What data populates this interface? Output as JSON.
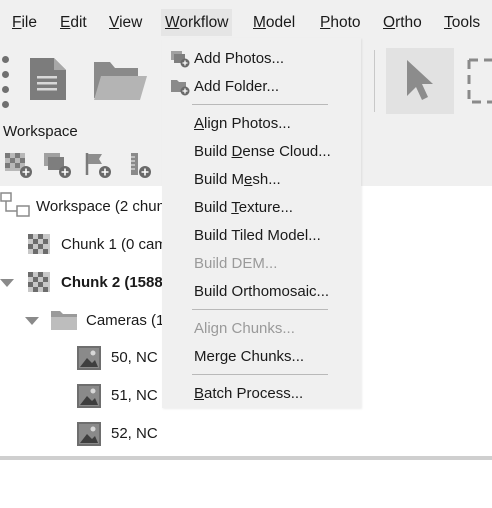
{
  "menubar": {
    "items": [
      {
        "pre": "",
        "u": "F",
        "post": "ile"
      },
      {
        "pre": "",
        "u": "E",
        "post": "dit"
      },
      {
        "pre": "",
        "u": "V",
        "post": "iew"
      },
      {
        "pre": "",
        "u": "W",
        "post": "orkflow"
      },
      {
        "pre": "",
        "u": "M",
        "post": "odel"
      },
      {
        "pre": "",
        "u": "P",
        "post": "hoto"
      },
      {
        "pre": "",
        "u": "O",
        "post": "rtho"
      },
      {
        "pre": "",
        "u": "T",
        "post": "ools"
      }
    ],
    "active_index": 3
  },
  "toolbar": {
    "icons": [
      "new-document-icon",
      "open-folder-icon",
      "pointer-icon",
      "selection-rectangle-icon"
    ]
  },
  "workspace": {
    "title": "Workspace",
    "tools": [
      "add-chunk-icon",
      "add-photos-icon",
      "add-marker-icon",
      "add-scalebar-icon"
    ],
    "tree": {
      "root": "Workspace (2 chun",
      "chunk1": "Chunk 1 (0 cam",
      "chunk2": "Chunk 2 (1588",
      "cameras": "Cameras (1",
      "photos": [
        "50, NC",
        "51, NC",
        "52, NC"
      ]
    }
  },
  "workflow_menu": {
    "add_photos": {
      "pre": "Add Photos...",
      "u": "",
      "post": ""
    },
    "add_folder": {
      "pre": "Add Folder...",
      "u": "",
      "post": ""
    },
    "align_photos": {
      "pre": "",
      "u": "A",
      "post": "lign Photos..."
    },
    "build_dense_cloud": {
      "pre": "Build ",
      "u": "D",
      "post": "ense Cloud..."
    },
    "build_mesh": {
      "pre": "Build M",
      "u": "e",
      "post": "sh..."
    },
    "build_texture": {
      "pre": "Build ",
      "u": "T",
      "post": "exture..."
    },
    "build_tiled_model": {
      "pre": "Build Tiled Model...",
      "u": "",
      "post": ""
    },
    "build_dem": {
      "pre": "Build DEM...",
      "u": "",
      "post": ""
    },
    "build_orthomosaic": {
      "pre": "Build Orthomosaic...",
      "u": "",
      "post": ""
    },
    "align_chunks": {
      "pre": "Align Chunks...",
      "u": "",
      "post": ""
    },
    "merge_chunks": {
      "pre": "Merge Chunks...",
      "u": "",
      "post": ""
    },
    "batch_process": {
      "pre": "",
      "u": "B",
      "post": "atch Process..."
    }
  },
  "colors": {
    "menu_bg": "#f0f0f0",
    "disabled_text": "#9a9a9a",
    "icon_gray": "#808080"
  }
}
